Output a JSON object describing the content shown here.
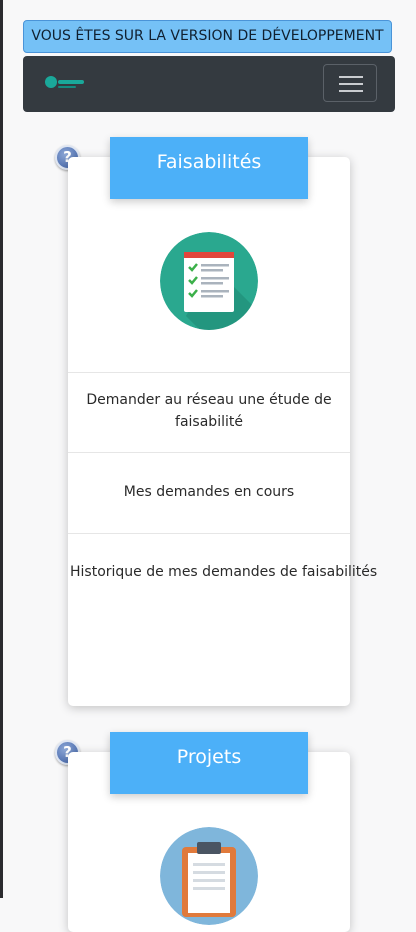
{
  "dev_banner": {
    "text": "VOUS ÊTES SUR LA VERSION DE DÉVELOPPEMENT"
  },
  "navbar": {
    "toggle_icon": "hamburger-icon",
    "brand_color": "#1aa89a"
  },
  "cards": [
    {
      "title": "Faisabilités",
      "illustration": "checklist-icon",
      "items": [
        {
          "label_line1": "Demander au réseau une étude de",
          "label_line2": "faisabilité"
        },
        {
          "label": "Mes demandes en cours"
        },
        {
          "label": "Historique de mes demandes de faisabilités"
        }
      ]
    },
    {
      "title": "Projets",
      "illustration": "clipboard-icon"
    }
  ],
  "colors": {
    "header_blue": "#4cb0f8",
    "banner_blue": "#75c1f6",
    "navbar": "#343a40"
  }
}
